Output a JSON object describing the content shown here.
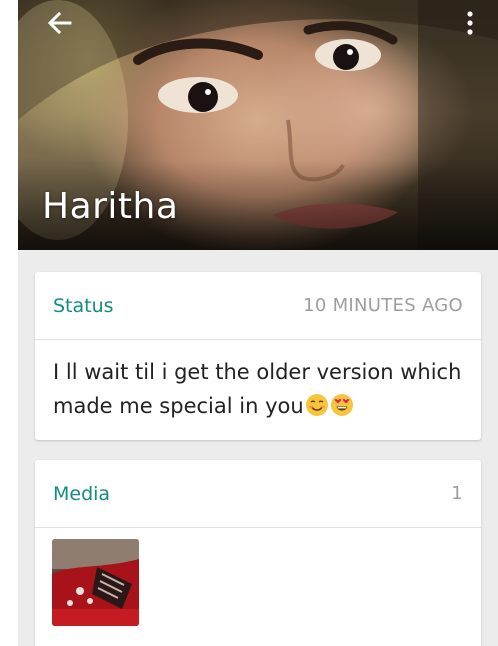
{
  "header": {
    "contact_name": "Haritha",
    "back_icon": "arrow-left-icon",
    "menu_icon": "more-vertical-icon"
  },
  "status_card": {
    "title": "Status",
    "time": "10 MINUTES AGO",
    "text": "I ll wait til i get the older version which made me special in you",
    "emojis": [
      "smiling-face-icon",
      "heart-eyes-face-icon"
    ]
  },
  "media_card": {
    "title": "Media",
    "count": "1"
  },
  "colors": {
    "accent": "#128c7e",
    "background": "#ececec",
    "meta_text": "#9e9e9e"
  }
}
